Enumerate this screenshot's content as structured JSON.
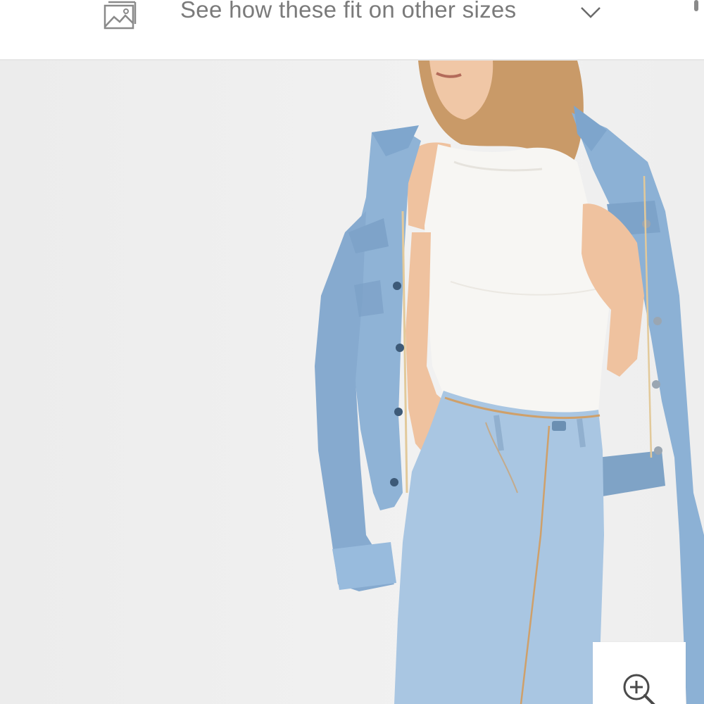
{
  "fit_bar": {
    "label": "See how these fit on other sizes",
    "image_icon": "image-gallery-icon",
    "chevron_icon": "chevron-down-icon"
  },
  "photo": {
    "icon": "product-photo"
  },
  "zoom": {
    "icon": "zoom-in-icon"
  },
  "colors": {
    "background": "#efefef",
    "label_text": "#7a7a7a",
    "denim": "#8fb4d8",
    "top": "#f7f6f3"
  }
}
